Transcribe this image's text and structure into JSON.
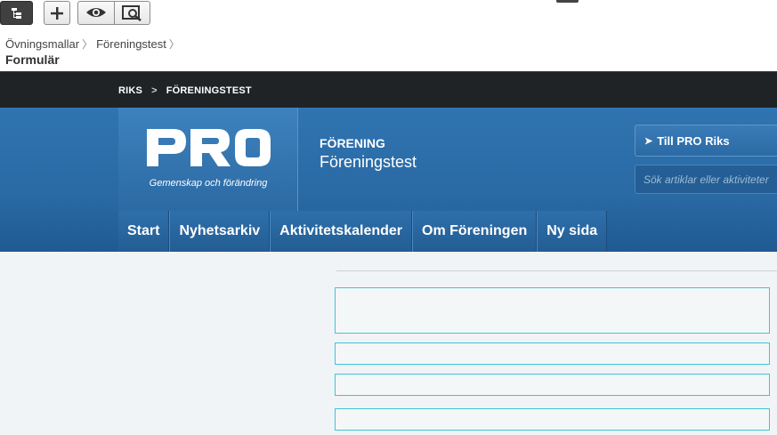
{
  "cms": {
    "toolbar": {
      "icons": [
        "structure-icon",
        "add-icon",
        "preview-icon",
        "compare-icon"
      ]
    },
    "breadcrumb": [
      "Övningsmallar",
      "Föreningstest"
    ],
    "page_title": "Formulär"
  },
  "site": {
    "breadcrumb": [
      "RIKS",
      "FÖRENINGSTEST"
    ],
    "logo": {
      "word": "PRO",
      "tagline": "Gemenskap och förändring"
    },
    "org": {
      "label": "FÖRENING",
      "name": "Föreningstest"
    },
    "pro_link": "Till PRO Riks",
    "search": {
      "placeholder": "Sök artiklar eller aktiviteter"
    },
    "nav": [
      "Start",
      "Nyhetsarkiv",
      "Aktivitetskalender",
      "Om Föreningen",
      "Ny sida"
    ]
  },
  "colors": {
    "header_blue": "#2a6aa5",
    "topbar": "#1f2326",
    "field_border": "#3ec5d6"
  }
}
